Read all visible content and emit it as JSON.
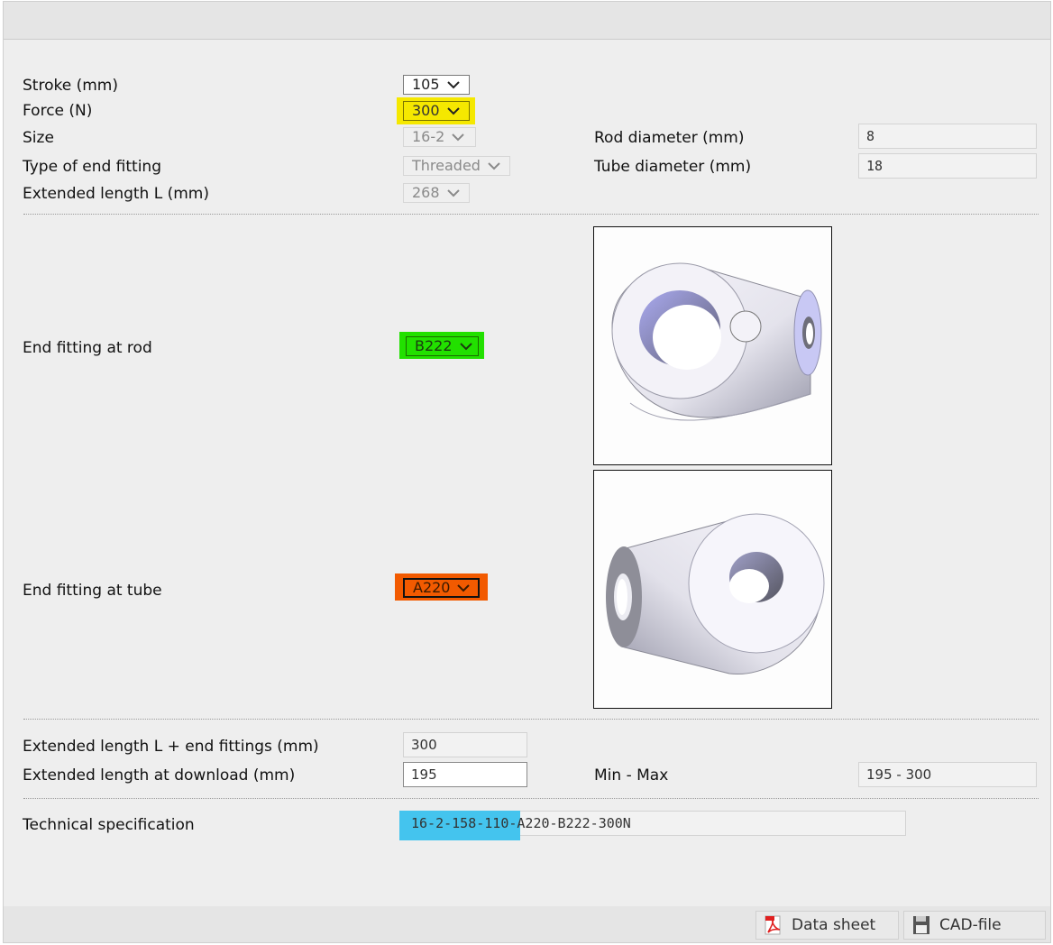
{
  "form": {
    "stroke": {
      "label": "Stroke (mm)",
      "value": "105"
    },
    "force": {
      "label": "Force (N)",
      "value": "300",
      "highlight": "#f5e800"
    },
    "size": {
      "label": "Size",
      "value": "16-2"
    },
    "type_end_fitting": {
      "label": "Type of end fitting",
      "value": "Threaded"
    },
    "extended_length": {
      "label": "Extended length L (mm)",
      "value": "268"
    },
    "rod_diameter": {
      "label": "Rod diameter (mm)",
      "value": "8"
    },
    "tube_diameter": {
      "label": "Tube diameter (mm)",
      "value": "18"
    }
  },
  "fittings": {
    "rod": {
      "label": "End fitting at rod",
      "value": "B222",
      "highlight": "#22e000",
      "image": "rod-end-fitting-eye-image"
    },
    "tube": {
      "label": "End fitting at tube",
      "value": "A220",
      "highlight": "#f25a00",
      "image": "tube-end-fitting-eye-image"
    }
  },
  "lengths": {
    "with_fittings": {
      "label": "Extended length L + end fittings (mm)",
      "value": "300"
    },
    "at_download": {
      "label": "Extended length at download (mm)",
      "value": "195"
    },
    "min_max": {
      "label": "Min - Max",
      "value": "195 - 300"
    }
  },
  "spec": {
    "label": "Technical specification",
    "value_selected": "16-2-158-110-",
    "value_rest": "A220-B222-300N",
    "highlight": "#44c4ee"
  },
  "footer": {
    "data_sheet": "Data sheet",
    "cad_file": "CAD-file"
  }
}
